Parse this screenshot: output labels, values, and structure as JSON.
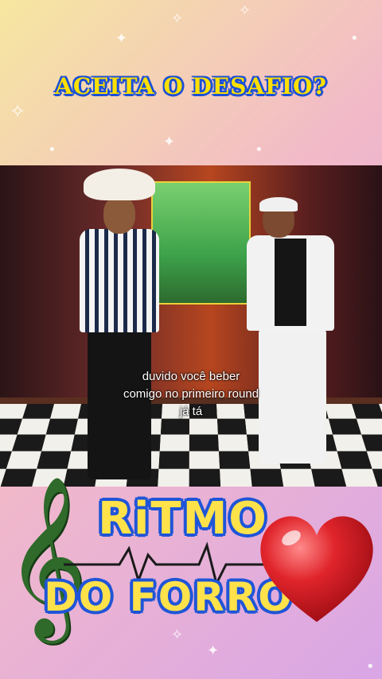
{
  "header": {
    "title": "ACEITA O DESAFIO?"
  },
  "video": {
    "subtitle_lines": [
      "duvido você beber",
      "comigo no primeiro round",
      "já tá"
    ]
  },
  "footer": {
    "line1": "RiTMO",
    "line2": "DO FORRÓ"
  },
  "colors": {
    "title_fill": "#ffe000",
    "title_outline": "#1b4fd6",
    "heart": "#e0242b",
    "treble_clef": "#2f6a2a"
  },
  "icons": {
    "treble_clef": "treble-clef-icon",
    "heart": "heart-icon",
    "pulse": "heartbeat-line-icon"
  }
}
